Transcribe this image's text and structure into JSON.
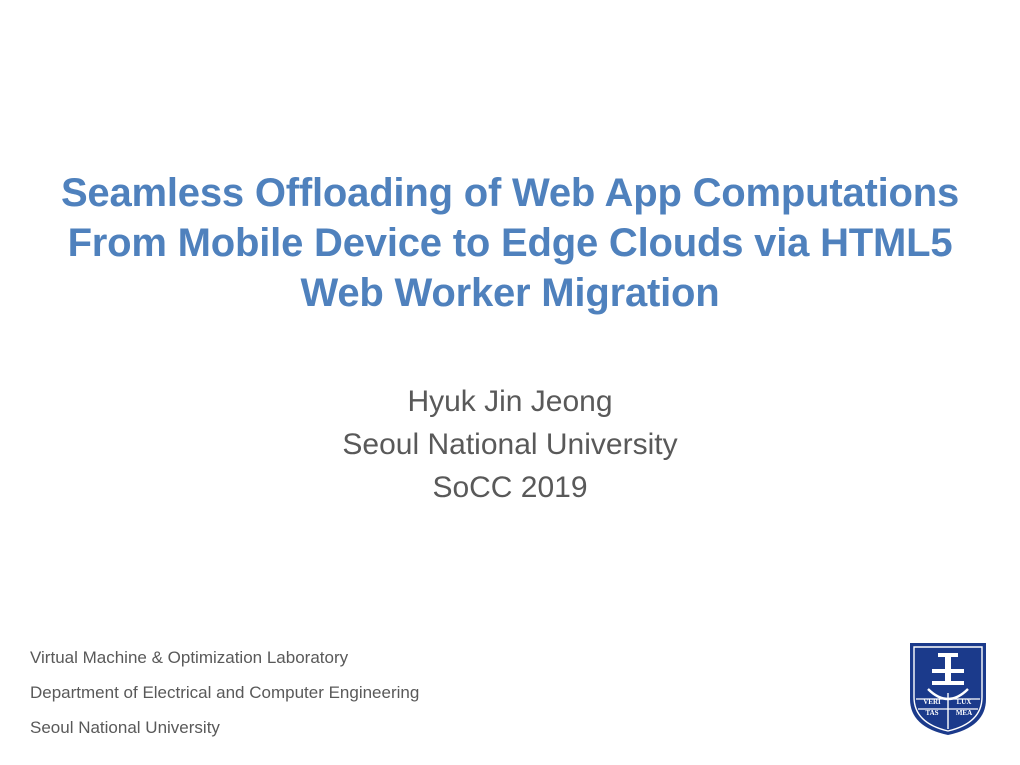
{
  "title": "Seamless Offloading of Web App Computations From Mobile Device to Edge Clouds via HTML5 Web Worker Migration",
  "subtitle": {
    "line1": "Hyuk Jin Jeong",
    "line2": "Seoul National University",
    "line3": "SoCC 2019"
  },
  "footer": {
    "line1": "Virtual Machine & Optimization Laboratory",
    "line2": "Department of Electrical and Computer Engineering",
    "line3": "Seoul National University"
  },
  "logo": {
    "name": "snu-emblem",
    "motto_left": "VERI TAS",
    "motto_right": "LUX MEA"
  },
  "colors": {
    "title": "#4F81BD",
    "body": "#595959",
    "logo": "#1B3A8B"
  }
}
